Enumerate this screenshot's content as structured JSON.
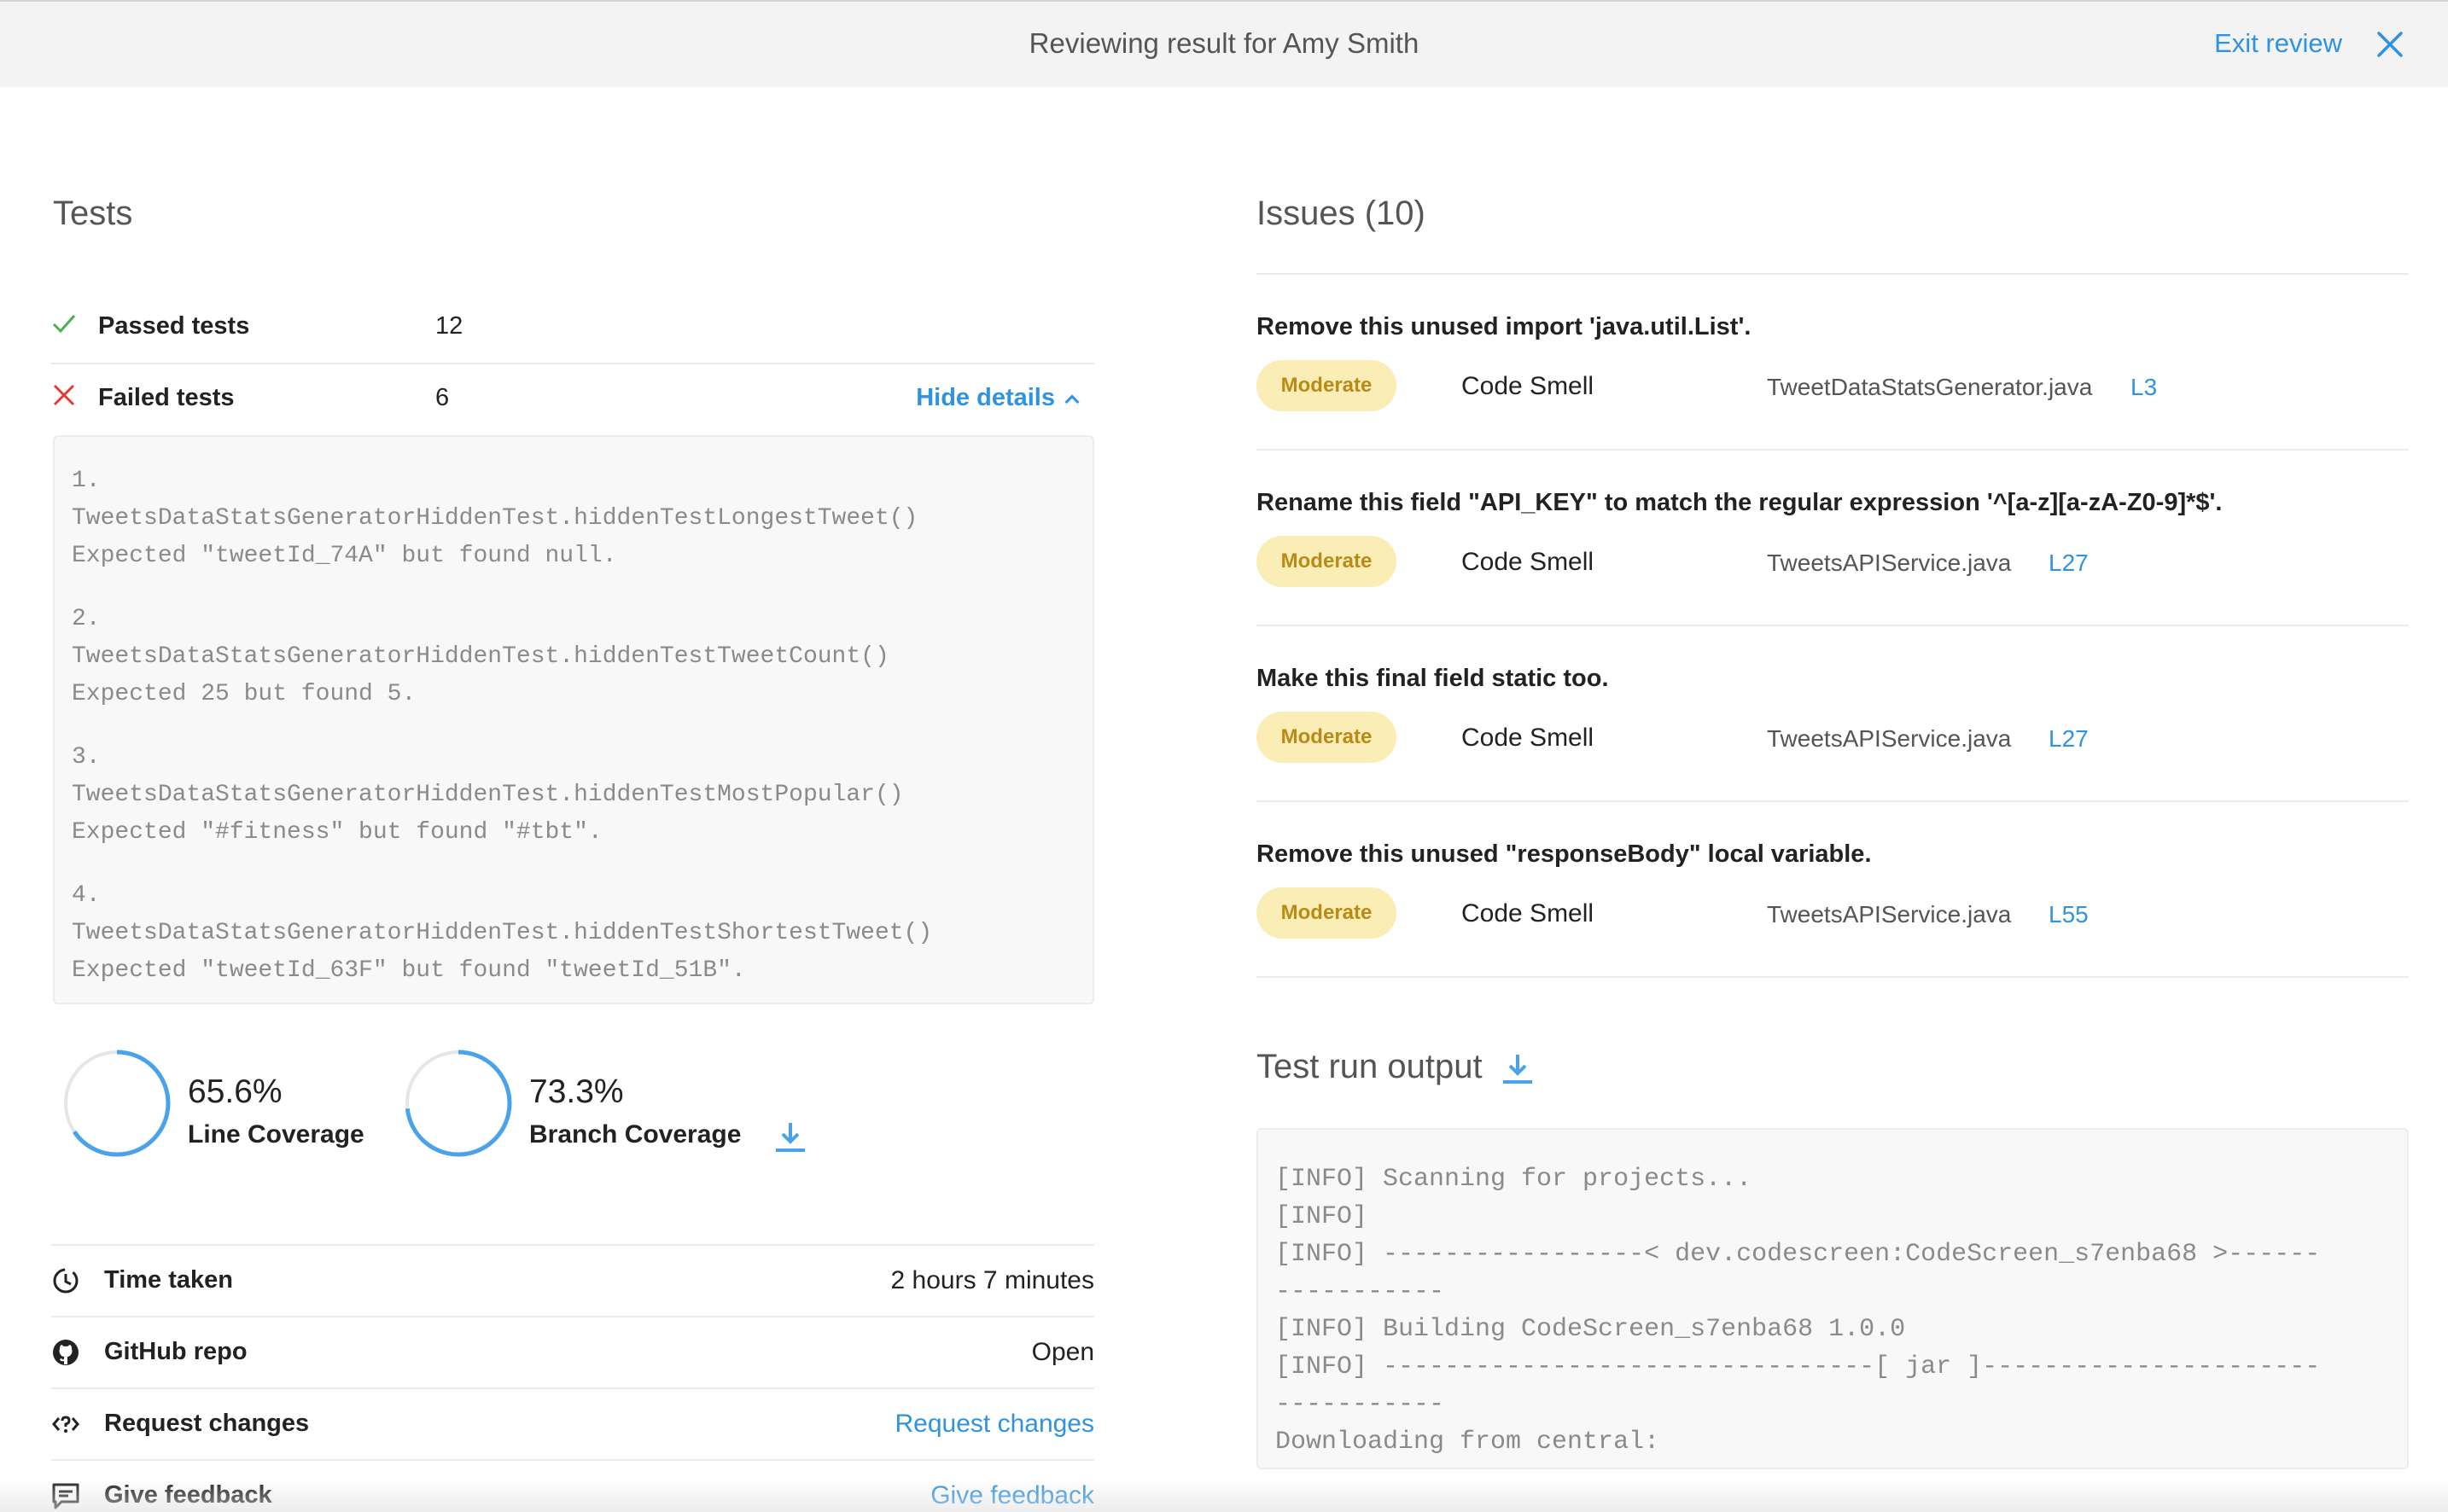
{
  "header": {
    "title": "Reviewing result for Amy Smith",
    "exit_label": "Exit review"
  },
  "tests": {
    "title": "Tests",
    "passed_label": "Passed tests",
    "passed_count": "12",
    "failed_label": "Failed tests",
    "failed_count": "6",
    "hide_details": "Hide details",
    "failures": [
      "1.\nTweetsDataStatsGeneratorHiddenTest.hiddenTestLongestTweet()\nExpected \"tweetId_74A\" but found null.",
      "2.\nTweetsDataStatsGeneratorHiddenTest.hiddenTestTweetCount()\nExpected 25 but found 5.",
      "3.\nTweetsDataStatsGeneratorHiddenTest.hiddenTestMostPopular()\nExpected \"#fitness\" but found \"#tbt\".",
      "4.\nTweetsDataStatsGeneratorHiddenTest.hiddenTestShortestTweet()\nExpected \"tweetId_63F\" but found \"tweetId_51B\"."
    ]
  },
  "coverage": {
    "line_pct": "65.6%",
    "line_label": "Line Coverage",
    "line_value": 0.656,
    "branch_pct": "73.3%",
    "branch_label": "Branch Coverage",
    "branch_value": 0.733
  },
  "info": {
    "time_label": "Time taken",
    "time_value": "2 hours 7 minutes",
    "repo_label": "GitHub repo",
    "repo_value": "Open",
    "request_label": "Request changes",
    "request_link": "Request changes",
    "feedback_label": "Give feedback",
    "feedback_link": "Give feedback"
  },
  "issues": {
    "title": "Issues (10)",
    "items": [
      {
        "message": "Remove this unused import 'java.util.List'.",
        "severity": "Moderate",
        "type": "Code Smell",
        "file": "TweetDataStatsGenerator.java",
        "line": "L3"
      },
      {
        "message": "Rename this field \"API_KEY\" to match the regular expression '^[a-z][a-zA-Z0-9]*$'.",
        "severity": "Moderate",
        "type": "Code Smell",
        "file": "TweetsAPIService.java",
        "line": "L27"
      },
      {
        "message": "Make this final field static too.",
        "severity": "Moderate",
        "type": "Code Smell",
        "file": "TweetsAPIService.java",
        "line": "L27"
      },
      {
        "message": "Remove this unused \"responseBody\" local variable.",
        "severity": "Moderate",
        "type": "Code Smell",
        "file": "TweetsAPIService.java",
        "line": "L55"
      }
    ]
  },
  "output": {
    "title": "Test run output",
    "lines": [
      "[INFO] Scanning for projects...",
      "[INFO]",
      "[INFO] -----------------< dev.codescreen:CodeScreen_s7enba68 >------",
      "-----------",
      "[INFO] Building CodeScreen_s7enba68 1.0.0",
      "[INFO] --------------------------------[ jar ]----------------------",
      "-----------",
      "Downloading from central:"
    ]
  },
  "colors": {
    "accent": "#2f93e0",
    "passed": "#4caf50",
    "failed": "#e53935",
    "badge_bg": "#faedb6",
    "badge_text": "#b98a16"
  },
  "icons": {
    "close": "close-icon",
    "check": "check-icon",
    "cross": "cross-icon",
    "download": "download-icon",
    "clock": "clock-icon",
    "github": "github-icon",
    "request": "request-changes-icon",
    "feedback": "feedback-icon"
  }
}
